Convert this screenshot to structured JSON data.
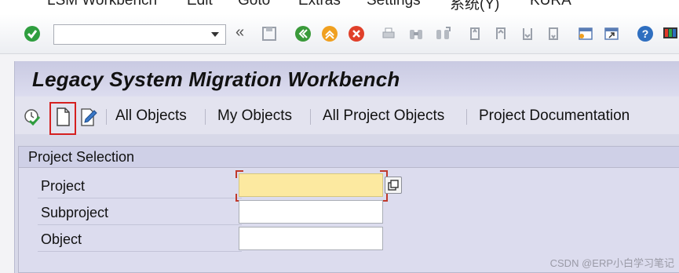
{
  "menu": {
    "items": [
      {
        "label": "LSM Workbench"
      },
      {
        "label": "Edit"
      },
      {
        "label": "Goto"
      },
      {
        "label": "Extras"
      },
      {
        "label": "Settings"
      },
      {
        "label": "系统(Y)"
      },
      {
        "label": "KURA"
      }
    ]
  },
  "toolbar": {
    "command_field_value": "",
    "history_glyph": "«"
  },
  "header": {
    "title": "Legacy System Migration Workbench"
  },
  "app_toolbar": {
    "buttons": [
      {
        "label": "All Objects"
      },
      {
        "label": "My Objects"
      },
      {
        "label": "All Project Objects"
      },
      {
        "label": "Project Documentation"
      }
    ],
    "icons": [
      "execute-clock-icon",
      "create-document-icon",
      "edit-pencil-icon"
    ]
  },
  "project_selection": {
    "title": "Project Selection",
    "fields": [
      {
        "label": "Project",
        "value": "",
        "required": true
      },
      {
        "label": "Subproject",
        "value": ""
      },
      {
        "label": "Object",
        "value": ""
      }
    ]
  },
  "watermark": "CSDN @ERP小白学习笔记",
  "colors": {
    "accept_green": "#2f9e3f",
    "back_green": "#3a9a3a",
    "exit_orange": "#f0a020",
    "cancel_red": "#e0402a",
    "required_field": "#fce9a0",
    "highlight_red": "#d52020",
    "title_bar": "#c9cae2"
  }
}
